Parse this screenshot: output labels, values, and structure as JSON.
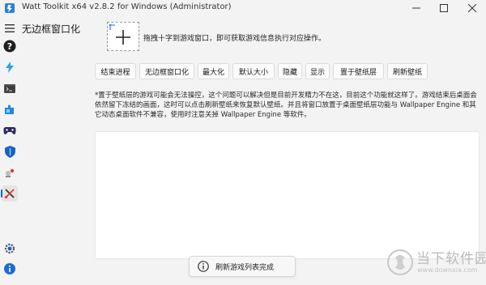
{
  "window": {
    "title": "Watt Toolkit x64 v2.8.2 for Windows (Administrator)",
    "logo_icon": "watt-toolkit-logo"
  },
  "titlebar_controls": [
    "minimize-icon",
    "maximize-icon",
    "close-icon"
  ],
  "sidebar": {
    "menu_icon": "hamburger-menu-icon",
    "items": [
      {
        "icon": "help-icon",
        "active": false
      },
      {
        "icon": "lightning-icon",
        "active": false
      },
      {
        "icon": "terminal-icon",
        "active": false
      },
      {
        "icon": "puzzle-icon",
        "active": false
      },
      {
        "icon": "gamepad-icon",
        "active": false
      },
      {
        "icon": "shield-icon",
        "active": false
      },
      {
        "icon": "tools-icon",
        "active": false
      },
      {
        "icon": "borderless-window-icon",
        "active": true
      }
    ],
    "bottom_items": [
      {
        "icon": "settings-gear-icon"
      },
      {
        "icon": "info-icon"
      }
    ]
  },
  "page": {
    "title": "无边框窗口化",
    "hint": "拖拽十字到游戏窗口，即可获取游戏信息执行对应操作。",
    "buttons": [
      "结束进程",
      "无边框窗口化",
      "最大化",
      "默认大小",
      "隐藏",
      "显示",
      "置于壁纸层",
      "刷新壁纸"
    ],
    "description": "*置于壁纸层的游戏可能会无法操控，这个问题可以解决但是目前开发精力不在这，目前这个功能就这样了。游戏结束后桌面会依然留下冻结的画面，这时可以点击刷新壁纸来恢复默认壁纸。并且将窗口放置于桌面壁纸层功能与 Wallpaper Engine 和其它动态桌面软件不兼容，使用时注意关掉 Wallpaper Engine 等软件。"
  },
  "toast": {
    "icon": "info-circle-icon",
    "text": "刷新游戏列表完成"
  },
  "watermark": {
    "title": "当下软件园",
    "subtitle": "www.downxia.com"
  },
  "colors": {
    "accent": "#1565c0",
    "background": "#f3f3f3",
    "help_badge": "#1f1f1f",
    "info_badge": "#1b6fd1"
  }
}
